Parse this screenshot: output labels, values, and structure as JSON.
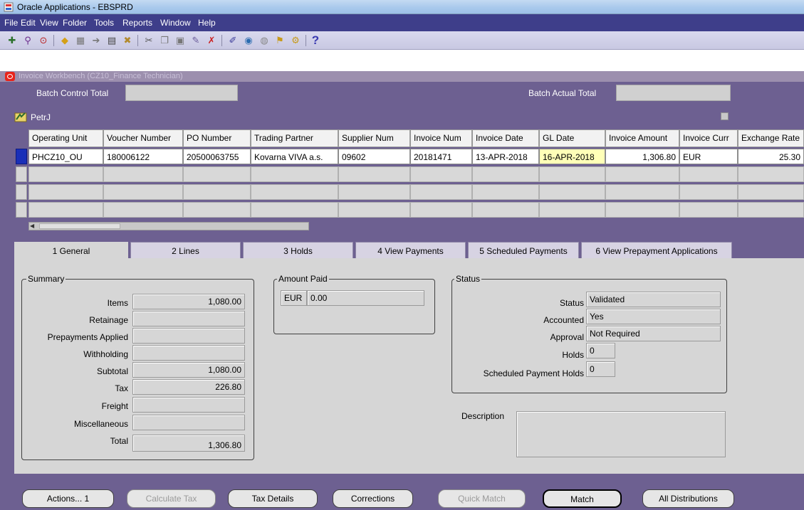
{
  "window": {
    "title": "Oracle Applications - EBSPRD"
  },
  "menu": [
    "File",
    "Edit",
    "View",
    "Folder",
    "Tools",
    "Reports",
    "Window",
    "Help"
  ],
  "toolbar_icons": [
    "new-record-icon",
    "find-icon",
    "navigator-icon",
    "open-folder-icon",
    "save-icon",
    "next-step-icon",
    "print-icon",
    "close-form-icon",
    "cut-icon",
    "copy-icon",
    "paste-icon",
    "clear-record-icon",
    "delete-record-icon",
    "edit-field-icon",
    "zoom-icon",
    "translations-icon",
    "attachments-icon",
    "folder-tools-icon",
    "help-icon"
  ],
  "form": {
    "window_title": "Invoice Workbench (CZ10_Finance Technician)",
    "batch_control_total_label": "Batch Control Total",
    "batch_control_total_value": "",
    "batch_actual_total_label": "Batch Actual Total",
    "batch_actual_total_value": "",
    "folder_name": "PetrJ"
  },
  "grid": {
    "columns": [
      "Operating Unit",
      "Voucher Number",
      "PO Number",
      "Trading Partner",
      "Supplier Num",
      "Invoice Num",
      "Invoice Date",
      "GL Date",
      "Invoice Amount",
      "Invoice Curr",
      "Exchange Rate"
    ],
    "rows": [
      [
        "PHCZ10_OU",
        "180006122",
        "20500063755",
        "Kovarna VIVA a.s.",
        "09602",
        "20181471",
        "13-APR-2018",
        "16-APR-2018",
        "1,306.80",
        "EUR",
        "25.30"
      ]
    ]
  },
  "tabs": [
    "1 General",
    "2 Lines",
    "3 Holds",
    "4 View Payments",
    "5 Scheduled Payments",
    "6 View Prepayment Applications"
  ],
  "summary": {
    "title": "Summary",
    "items_label": "Items",
    "items_value": "1,080.00",
    "retainage_label": "Retainage",
    "retainage_value": "",
    "prepayments_label": "Prepayments Applied",
    "prepayments_value": "",
    "withholding_label": "Withholding",
    "withholding_value": "",
    "subtotal_label": "Subtotal",
    "subtotal_value": "1,080.00",
    "tax_label": "Tax",
    "tax_value": "226.80",
    "freight_label": "Freight",
    "freight_value": "",
    "misc_label": "Miscellaneous",
    "misc_value": "",
    "total_label": "Total",
    "total_value": "1,306.80"
  },
  "amount_paid": {
    "title": "Amount Paid",
    "currency": "EUR",
    "value": "0.00"
  },
  "status": {
    "title": "Status",
    "status_label": "Status",
    "status_value": "Validated",
    "accounted_label": "Accounted",
    "accounted_value": "Yes",
    "approval_label": "Approval",
    "approval_value": "Not Required",
    "holds_label": "Holds",
    "holds_value": "0",
    "sched_holds_label": "Scheduled Payment Holds",
    "sched_holds_value": "0"
  },
  "description": {
    "label": "Description",
    "value": ""
  },
  "buttons": {
    "actions": "Actions... 1",
    "calculate_tax": "Calculate Tax",
    "tax_details": "Tax Details",
    "corrections": "Corrections",
    "quick_match": "Quick Match",
    "match": "Match",
    "all_distributions": "All Distributions"
  }
}
